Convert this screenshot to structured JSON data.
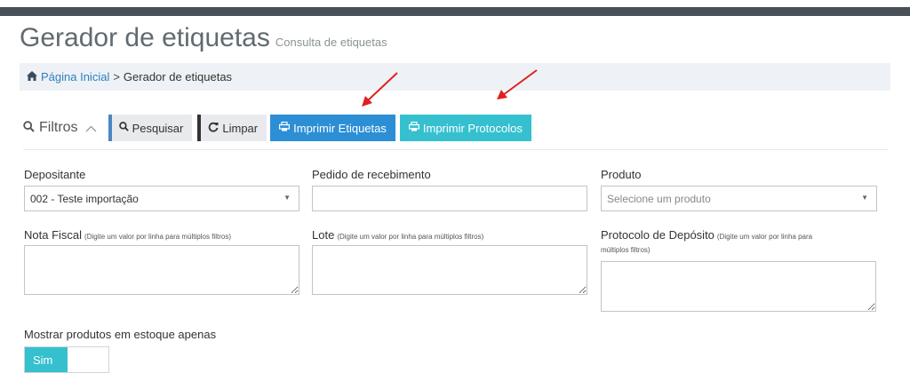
{
  "header": {
    "title": "Gerador de etiquetas",
    "subtitle": "Consulta de etiquetas"
  },
  "breadcrumb": {
    "home_icon": "home-icon",
    "home_label": "Página Inicial",
    "separator": ">",
    "current": "Gerador de etiquetas"
  },
  "toolbar": {
    "filters_icon": "search-icon",
    "filters_label": "Filtros",
    "filters_toggle_icon": "chevron-up-icon",
    "search_label": "Pesquisar",
    "clear_label": "Limpar",
    "print_labels_label": "Imprimir Etiquetas",
    "print_protocols_label": "Imprimir Protocolos"
  },
  "colors": {
    "primary_button": "#2c8fd6",
    "info_button": "#35c0cf",
    "annotation_arrow": "#e02020"
  },
  "form": {
    "depositante": {
      "label": "Depositante",
      "value": "002 - Teste importação"
    },
    "pedido": {
      "label": "Pedido de recebimento",
      "value": ""
    },
    "produto": {
      "label": "Produto",
      "placeholder": "Selecione um produto"
    },
    "nota_fiscal": {
      "label": "Nota Fiscal",
      "hint": "(Digite um valor por linha para múltiplos filtros)"
    },
    "lote": {
      "label": "Lote",
      "hint": "(Digite um valor por linha para múltiplos filtros)"
    },
    "protocolo": {
      "label": "Protocolo de Depósito",
      "hint_line1": "(Digite um valor por linha para",
      "hint_line2": "múltiplos filtros)"
    },
    "stock_only": {
      "label": "Mostrar produtos em estoque apenas",
      "toggle_on_label": "Sim"
    }
  }
}
